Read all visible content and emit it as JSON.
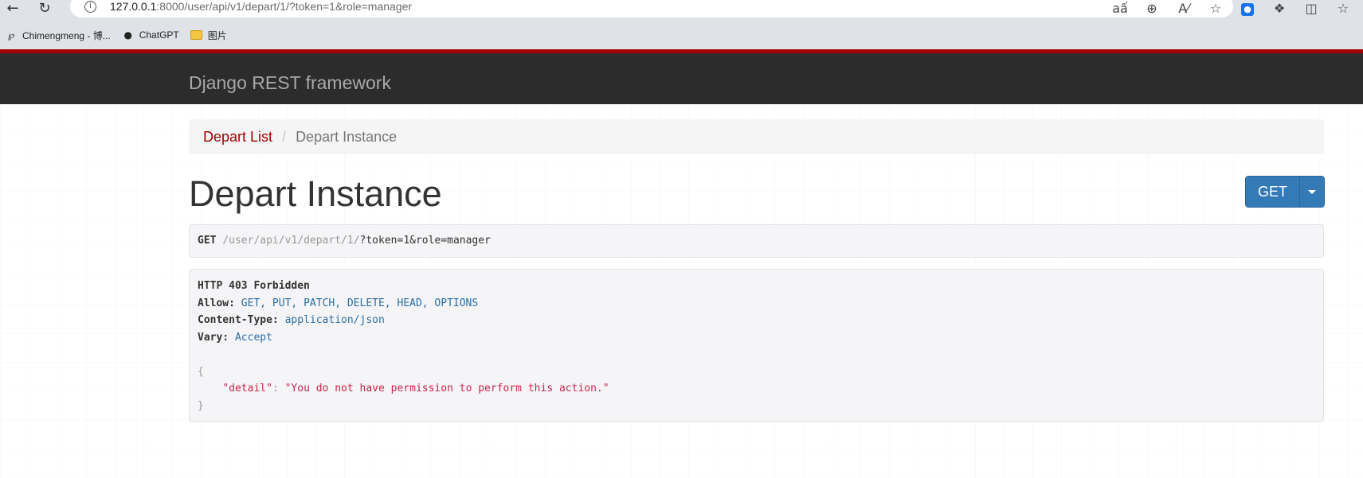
{
  "browser": {
    "url_host": "127.0.0.1",
    "url_rest": ":8000/user/api/v1/depart/1/?token=1&role=manager",
    "bookmarks": [
      {
        "label": "Chimengmeng - 博..."
      },
      {
        "label": "ChatGPT"
      },
      {
        "label": "图片"
      }
    ]
  },
  "navbar": {
    "brand": "Django REST framework"
  },
  "breadcrumb": {
    "link": "Depart List",
    "separator": "/",
    "active": "Depart Instance"
  },
  "page": {
    "title": "Depart Instance",
    "method_button": "GET"
  },
  "request": {
    "method": "GET",
    "path_parts": [
      "/user",
      "/api",
      "/v1",
      "/depart",
      "/1",
      "/",
      "?token",
      "=1",
      "&role",
      "=manager"
    ]
  },
  "response": {
    "status": "HTTP 403 Forbidden",
    "headers": [
      {
        "name": "Allow:",
        "value": "GET, PUT, PATCH, DELETE, HEAD, OPTIONS"
      },
      {
        "name": "Content-Type:",
        "value": "application/json"
      },
      {
        "name": "Vary:",
        "value": "Accept"
      }
    ],
    "body_open": "{",
    "body_key": "\"detail\"",
    "body_colon": ": ",
    "body_value": "\"You do not have permission to perform this action.\"",
    "body_close": "}"
  }
}
